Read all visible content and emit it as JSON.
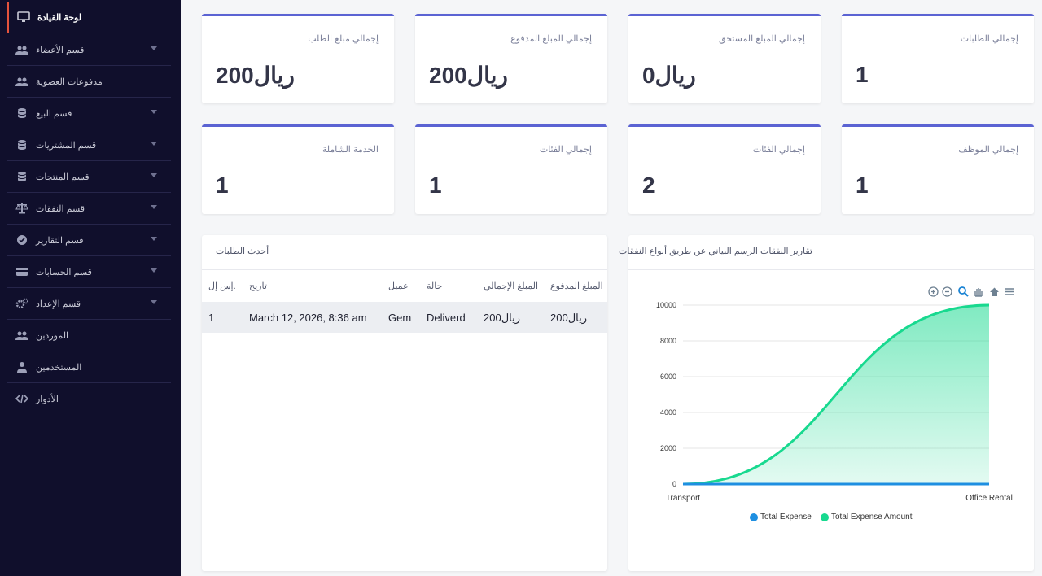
{
  "sidebar": {
    "items": [
      {
        "label": "لوحة القيادة",
        "icon": "monitor-icon",
        "active": true
      },
      {
        "label": "قسم الأعضاء",
        "icon": "users-icon",
        "expandable": true
      },
      {
        "label": "مدفوعات العضوية",
        "icon": "users-icon",
        "expandable": false
      },
      {
        "label": "قسم البيع",
        "icon": "database-icon",
        "expandable": true
      },
      {
        "label": "قسم المشتريات",
        "icon": "database-icon",
        "expandable": true
      },
      {
        "label": "قسم المنتجات",
        "icon": "database-icon",
        "expandable": true
      },
      {
        "label": "قسم النفقات",
        "icon": "scale-icon",
        "expandable": true
      },
      {
        "label": "قسم التقارير",
        "icon": "check-circle-icon",
        "expandable": true
      },
      {
        "label": "قسم الحسابات",
        "icon": "credit-card-icon",
        "expandable": true
      },
      {
        "label": "قسم الإعداد",
        "icon": "gears-icon",
        "expandable": true
      },
      {
        "label": "الموردين",
        "icon": "users-icon",
        "expandable": false
      },
      {
        "label": "المستخدمين",
        "icon": "user-icon",
        "expandable": false
      },
      {
        "label": "الأدوار",
        "icon": "code-icon",
        "expandable": false
      }
    ]
  },
  "stats": {
    "row1": [
      {
        "title": "إجمالي الطلبات",
        "value": "1"
      },
      {
        "title": "إجمالي المبلغ المستحق",
        "value": "ريال0"
      },
      {
        "title": "إجمالي المبلغ المدفوع",
        "value": "ريال200"
      },
      {
        "title": "إجمالي مبلغ الطلب",
        "value": "ريال200"
      }
    ],
    "row2": [
      {
        "title": "إجمالي الموظف",
        "value": "1"
      },
      {
        "title": "إجمالي الفئات",
        "value": "2"
      },
      {
        "title": "إجمالي الفئات",
        "value": "1"
      },
      {
        "title": "الخدمة الشاملة",
        "value": "1"
      }
    ]
  },
  "orders": {
    "title": "أحدث الطلبات",
    "columns": [
      "إس إل.",
      "تاريخ",
      "عميل",
      "حالة",
      "المبلغ الإجمالي",
      "المبلغ المدفوع"
    ],
    "rows": [
      {
        "sl": "1",
        "date": "March 12, 2026, 8:36 am",
        "customer": "Gem",
        "status": "Deliverd",
        "total": "ريال200",
        "paid": "ريال200"
      }
    ]
  },
  "expense_chart": {
    "title": "تقارير النفقات الرسم البياني عن طريق أنواع النفقات",
    "toolbar": [
      "zoom-in-icon",
      "zoom-out-icon",
      "magnifier-icon",
      "pan-hand-icon",
      "home-icon",
      "menu-icon"
    ]
  },
  "chart_data": {
    "type": "area",
    "categories": [
      "Transport",
      "Office Rental"
    ],
    "series": [
      {
        "name": "Total Expense",
        "values": [
          0,
          0
        ],
        "color": "#1e8fe1"
      },
      {
        "name": "Total Expense Amount",
        "values": [
          0,
          10000
        ],
        "color": "#18d98f"
      }
    ],
    "ylim": [
      0,
      10000
    ],
    "yticks": [
      "0",
      "2000",
      "4000",
      "6000",
      "8000",
      "10000"
    ],
    "legend": "bottom",
    "grid": true
  },
  "colors": {
    "accent": "#5b63d3",
    "sidebar_bg": "#100f2c",
    "active_marker": "#e5533d"
  }
}
